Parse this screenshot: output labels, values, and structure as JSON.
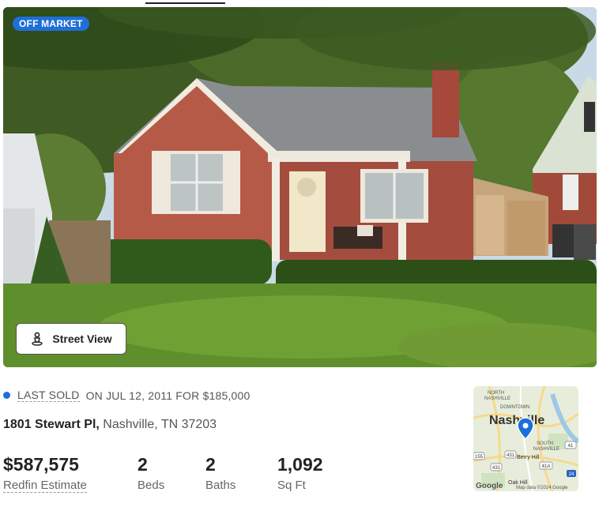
{
  "listing": {
    "status_badge": "OFF MARKET",
    "street_view_label": "Street View",
    "sold": {
      "label": "LAST SOLD",
      "detail": "ON JUL 12, 2011 FOR $185,000"
    },
    "address": {
      "street": "1801 Stewart Pl,",
      "city_state_zip": "Nashville, TN 37203"
    },
    "stats": {
      "price": {
        "value": "$587,575",
        "label": "Redfin Estimate"
      },
      "beds": {
        "value": "2",
        "label": "Beds"
      },
      "baths": {
        "value": "2",
        "label": "Baths"
      },
      "sqft": {
        "value": "1,092",
        "label": "Sq Ft"
      }
    }
  },
  "map": {
    "labels": {
      "north": "NORTH",
      "nashville_small": "NASHVILLE",
      "downtown": "DOWNTOWN",
      "city": "Nashville",
      "south": "SOUTH",
      "south_nashville": "NASHVILLE",
      "berry_hill": "Berry Hill",
      "oak_hill": "Oak Hill"
    },
    "route_shields": [
      "155",
      "431",
      "431",
      "41",
      "41A",
      "24"
    ],
    "google_logo": "Google",
    "attribution": "Map data ©2024 Google"
  },
  "colors": {
    "accent": "#1e6fd9",
    "text_primary": "#222222",
    "text_secondary": "#555555"
  },
  "icons": {
    "street_view": "pegman-icon",
    "map_pin": "location-pin-icon"
  }
}
